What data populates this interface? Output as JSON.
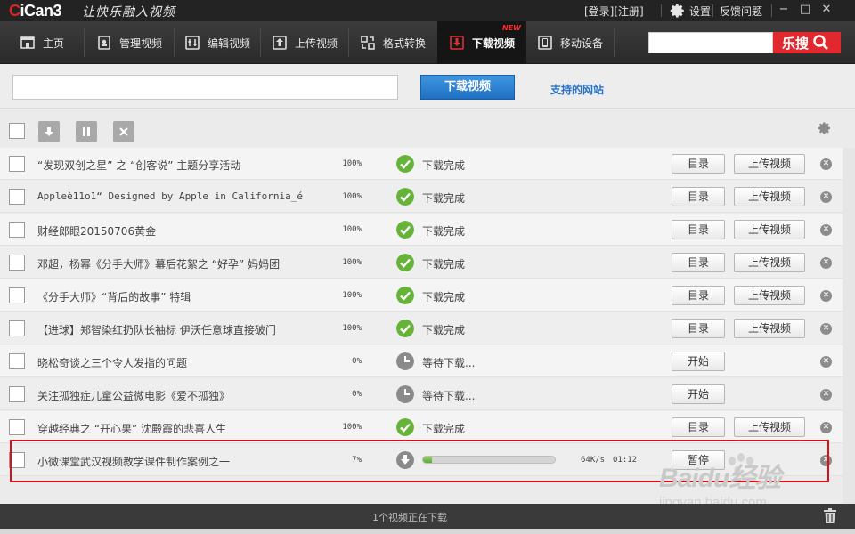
{
  "app": {
    "logo_c": "C",
    "logo_rest": "iCan3",
    "slogan": "让快乐融入视频",
    "login": "[登录]",
    "register": "[注册]",
    "settings": "设置",
    "feedback": "反馈问题",
    "win_min": "−",
    "win_max": "□",
    "win_close": "✕"
  },
  "nav": {
    "items": [
      {
        "label": "主页",
        "icon": "home-icon"
      },
      {
        "label": "管理视频",
        "icon": "manage-video-icon"
      },
      {
        "label": "编辑视频",
        "icon": "edit-video-icon"
      },
      {
        "label": "上传视频",
        "icon": "upload-icon"
      },
      {
        "label": "格式转换",
        "icon": "convert-icon"
      },
      {
        "label": "下载视频",
        "icon": "download-icon",
        "active": true,
        "badge": "NEW"
      },
      {
        "label": "移动设备",
        "icon": "mobile-device-icon"
      }
    ],
    "search_placeholder": "",
    "search_button": "乐搜"
  },
  "url_bar": {
    "placeholder": "",
    "download_button": "下载视频",
    "support_link": "支持的网站"
  },
  "rows": [
    {
      "title": "“发现双创之星” 之 “创客说” 主题分享活动",
      "pct": "100%",
      "status": "下载完成",
      "state": "done",
      "btn1": "目录",
      "btn2": "上传视频"
    },
    {
      "title": "Appleè11o1“ Designed by Apple in California_é",
      "pct": "100%",
      "status": "下载完成",
      "state": "done",
      "btn1": "目录",
      "btn2": "上传视频",
      "mono": true
    },
    {
      "title": "财经郎眼20150706黄金",
      "pct": "100%",
      "status": "下载完成",
      "state": "done",
      "btn1": "目录",
      "btn2": "上传视频"
    },
    {
      "title": "邓超，杨幂《分手大师》幕后花絮之 “好孕” 妈妈团",
      "pct": "100%",
      "status": "下载完成",
      "state": "done",
      "btn1": "目录",
      "btn2": "上传视频"
    },
    {
      "title": "《分手大师》“背后的故事” 特辑",
      "pct": "100%",
      "status": "下载完成",
      "state": "done",
      "btn1": "目录",
      "btn2": "上传视频"
    },
    {
      "title": "【进球】郑智染红扔队长袖标 伊沃任意球直接破门",
      "pct": "100%",
      "status": "下载完成",
      "state": "done",
      "btn1": "目录",
      "btn2": "上传视频"
    },
    {
      "title": "晓松奇谈之三个令人发指的问题",
      "pct": "0%",
      "status": "等待下载...",
      "state": "wait",
      "btn1": "开始"
    },
    {
      "title": "关注孤独症儿童公益微电影《爱不孤独》",
      "pct": "0%",
      "status": "等待下载...",
      "state": "wait",
      "btn1": "开始"
    },
    {
      "title": "穿越经典之 “开心果” 沈殿霞的悲喜人生",
      "pct": "100%",
      "status": "下载完成",
      "state": "done",
      "btn1": "目录",
      "btn2": "上传视频"
    },
    {
      "title": "小微课堂武汉视频教学课件制作案例之一",
      "pct": "7%",
      "state": "downloading",
      "progress": 0.07,
      "speed": "64K/s",
      "time": "01:12",
      "btn1": "暂停"
    }
  ],
  "footer": {
    "status": "1个视频正在下载"
  },
  "watermark": {
    "brand": "Baidu经验",
    "url": "jingyan.baidu.com"
  },
  "colors": {
    "accent_blue": "#2a73c8",
    "done_green": "#66b33a",
    "highlight_red": "#d9101c",
    "search_red": "#e0282e"
  }
}
